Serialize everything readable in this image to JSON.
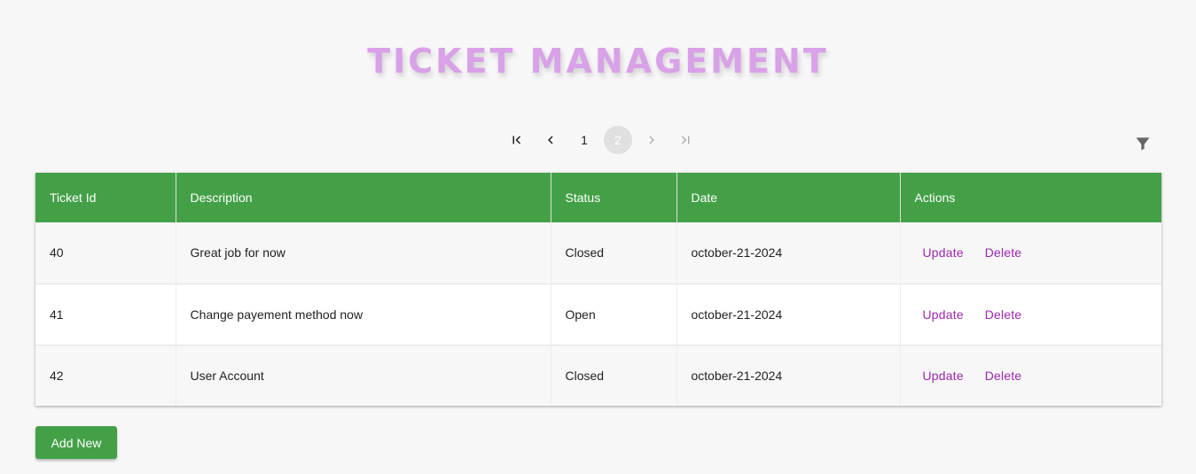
{
  "header": {
    "title": "TICKET MANAGEMENT"
  },
  "pagination": {
    "pages": [
      "1",
      "2"
    ],
    "current_page": "2",
    "first_icon": "first-page-icon",
    "prev_icon": "chevron-left-icon",
    "next_icon": "chevron-right-icon",
    "last_icon": "last-page-icon"
  },
  "filter": {
    "icon": "filter-icon"
  },
  "table": {
    "columns": [
      "Ticket Id",
      "Description",
      "Status",
      "Date",
      "Actions"
    ],
    "rows": [
      {
        "id": "40",
        "description": "Great job for now",
        "status": "Closed",
        "date": "october-21-2024",
        "update_label": "Update",
        "delete_label": "Delete"
      },
      {
        "id": "41",
        "description": "Change payement method now",
        "status": "Open",
        "date": "october-21-2024",
        "update_label": "Update",
        "delete_label": "Delete"
      },
      {
        "id": "42",
        "description": "User Account",
        "status": "Closed",
        "date": "october-21-2024",
        "update_label": "Update",
        "delete_label": "Delete"
      }
    ]
  },
  "add_button": {
    "label": "Add New"
  },
  "colors": {
    "title": "#d9a1e8",
    "header_bg": "#43a047",
    "action_text": "#9c27b0",
    "page_bg": "#f7f7f7"
  }
}
